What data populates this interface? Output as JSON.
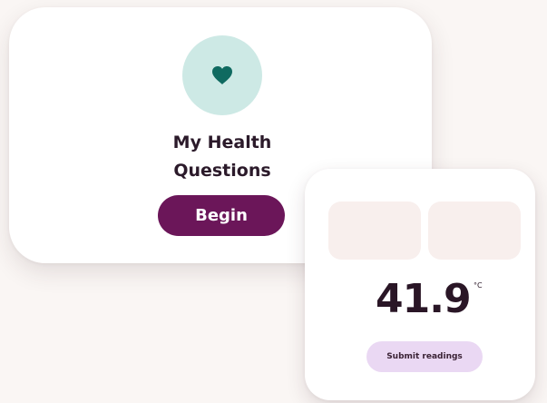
{
  "health_card": {
    "icon": "heart-icon",
    "title_line1": "My Health",
    "title_line2": "Questions",
    "begin_label": "Begin",
    "colors": {
      "icon_circle": "#cde9e5",
      "heart": "#0f6a60",
      "button": "#6b1659"
    }
  },
  "readings_card": {
    "value": "41.9",
    "unit": "°C",
    "submit_label": "Submit readings",
    "colors": {
      "placeholder": "#f8efed",
      "submit_button": "#ead8f3"
    }
  }
}
